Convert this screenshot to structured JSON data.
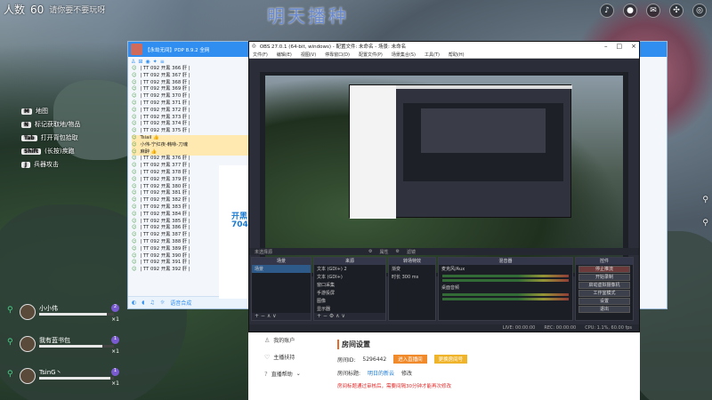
{
  "hud": {
    "players_label": "人数",
    "players_count": "60",
    "subtitle": "请你要不要玩呀",
    "watermark": "明天播种",
    "icons": [
      "bell-icon",
      "mic-icon",
      "chat-icon",
      "settings-icon",
      "compass-icon"
    ]
  },
  "keyhints": [
    {
      "key": "M",
      "label": "地图"
    },
    {
      "key": "N",
      "label": "标记获取地/物品"
    },
    {
      "key": "Tab",
      "label": "打开背包拾取"
    },
    {
      "key": "Shift",
      "label": "(长按)疾跑"
    },
    {
      "key": "J",
      "label": "兵器攻击"
    }
  ],
  "party": [
    {
      "name": "小小伟",
      "level": "2",
      "count": "×1",
      "hp": 0.9
    },
    {
      "name": "我有蓝书包",
      "level": "1",
      "count": "×1",
      "hp": 0.85
    },
    {
      "name": "TsinG丶",
      "level": "1",
      "count": "×1",
      "hp": 0.95
    }
  ],
  "yy": {
    "title": "【永劫无间】PDP 8.9.2 全网",
    "rows": [
      "| TT 092  开黑  366 肝  |",
      "| TT 092  开黑  367 肝  |",
      "| TT 092  开黑  368 肝  |",
      "| TT 092  开黑  369 肝  |",
      "| TT 092  开黑  370 肝  |",
      "| TT 092  开黑  371 肝  |",
      "| TT 092  开黑  372 肝  |",
      "| TT 092  开黑  373 肝  |",
      "| TT 092  开黑  374 肝  |",
      "| TT 092  开黑  375 肝  |",
      "Tsiail 👍",
      "小伟-宁红夜-韩咏-刀魂",
      "麻醉 👍",
      "| TT 092  开黑  376 肝  |",
      "| TT 092  开黑  377 肝  |",
      "| TT 092  开黑  378 肝  |",
      "| TT 092  开黑  379 肝  |",
      "| TT 092  开黑  380 肝  |",
      "| TT 092  开黑  381 肝  |",
      "| TT 092  开黑  382 肝  |",
      "| TT 092  开黑  383 肝  |",
      "| TT 092  开黑  384 肝  |",
      "| TT 092  开黑  385 肝  |",
      "| TT 092  开黑  386 肝  |",
      "| TT 092  开黑  387 肝  |",
      "| TT 092  开黑  388 肝  |",
      "| TT 092  开黑  389 肝  |",
      "| TT 092  开黑  390 肝  |",
      "| TT 092  开黑  391 肝  |",
      "| TT 092  开黑  392 肝  |"
    ],
    "footer": "语音合成",
    "side_open": "开黑",
    "side_num": "7043"
  },
  "obs": {
    "title": "OBS 27.0.1 (64-bit, windows) - 配置文件: 未命名 - 场景: 未命名",
    "tab": "主播中心",
    "menu": [
      "文件(F)",
      "编辑(E)",
      "视图(V)",
      "停靠窗口(D)",
      "配置文件(P)",
      "场景集合(S)",
      "工具(T)",
      "帮助(H)"
    ],
    "status_left": "未选择源",
    "status_props": "属性",
    "status_filter": "滤镜",
    "docks": {
      "scenes": {
        "title": "场景",
        "items": [
          "场景"
        ]
      },
      "sources": {
        "title": "来源",
        "items": [
          "文本 (GDI+) 2",
          "文本 (GDI+)",
          "窗口采集",
          "手游投屏",
          "图像",
          "显示器"
        ]
      },
      "transitions": {
        "title": "转场特效",
        "items": [
          "渐变",
          "时长 300 ms"
        ]
      },
      "mixer": {
        "title": "混音器",
        "items": [
          "麦克风/Aux",
          "桌面音频"
        ]
      },
      "controls": {
        "title": "控件",
        "items": [
          "停止推流",
          "开始录制",
          "启动虚拟摄像机",
          "工作室模式",
          "设置",
          "退出"
        ]
      }
    },
    "bottom": [
      "LIVE: 00:00:00",
      "REC: 00:00:00",
      "CPU: 1.1%, 60.00 fps"
    ]
  },
  "web": {
    "nav": [
      "我的账户",
      "主播扶持",
      "直播帮助"
    ],
    "heading": "房间设置",
    "room_id_label": "房间ID:",
    "room_id": "5296442",
    "btn_enter": "进入直播间",
    "btn_apply": "更换房间号",
    "title_label": "房间标题:",
    "title_value": "明日的新云",
    "edit": "修改",
    "warning": "房间标题通过审核后，需要间隔30分钟才能再次修改"
  },
  "colors": {
    "accent": "#2f8ef0",
    "obs_bg": "#2b2e38",
    "warn": "#e02a2a",
    "orange": "#f08a2a"
  }
}
